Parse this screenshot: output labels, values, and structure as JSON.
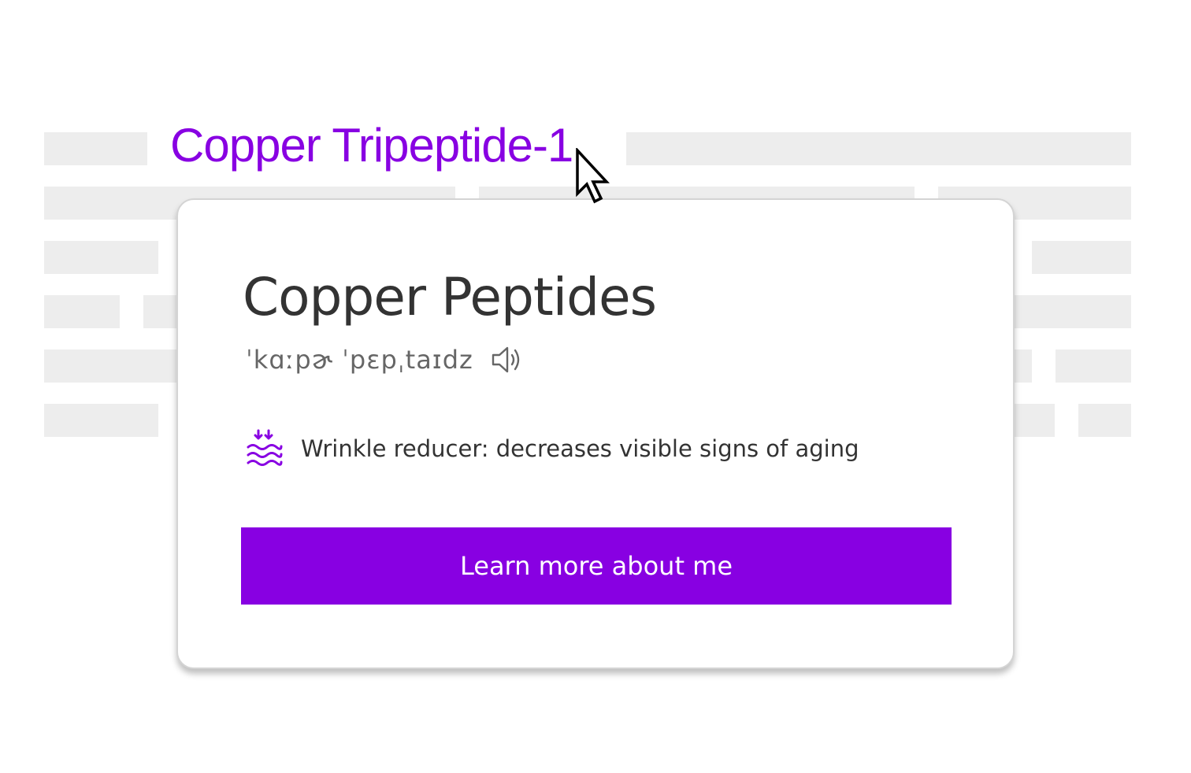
{
  "colors": {
    "accent": "#8800e2",
    "placeholder": "#ededed",
    "title_text": "#333333",
    "muted_text": "#666666"
  },
  "term_link": {
    "label": "Copper Tripeptide-1"
  },
  "popover": {
    "title": "Copper Peptides",
    "pronunciation": "ˈkɑːpɚ ˈpɛpˌtaɪdz",
    "pronunciation_icon": "speaker-icon",
    "benefit": {
      "icon": "wrinkle-reducer-icon",
      "text": "Wrinkle reducer: decreases visible signs of aging"
    },
    "cta_label": "Learn more about me"
  },
  "cursor_icon": "mouse-pointer-icon"
}
